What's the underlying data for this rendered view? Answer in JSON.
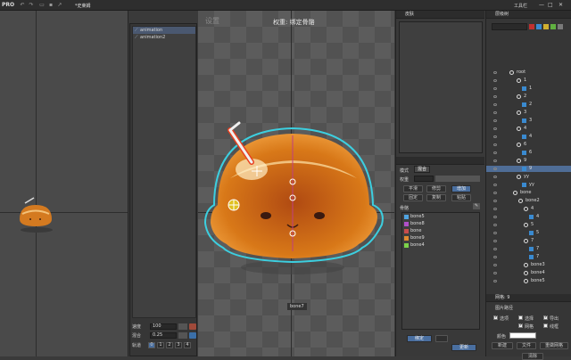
{
  "app": {
    "brand": "PRO",
    "tab_title": "*史莱姆",
    "window_controls": [
      "—",
      "□",
      "✕"
    ],
    "title_right_label": "工具栏"
  },
  "viewport": {
    "mode_label": "设置",
    "title": "权重: 绑定骨骼",
    "bone_label": "bone7"
  },
  "animations": {
    "items": [
      {
        "label": "animation",
        "selected": true
      },
      {
        "label": "animation2",
        "selected": false
      }
    ],
    "speed_label": "速度",
    "speed_value": "100",
    "mix_label": "混合",
    "mix_value": "0.25",
    "track_label": "轨道",
    "tracks": [
      "0",
      "1",
      "2",
      "3",
      "4"
    ]
  },
  "weights_panel": {
    "header": "皮肤",
    "mode_label": "模式",
    "mode_value": "混合",
    "weight_label": "权重",
    "buttons_row1": [
      "平滑",
      "修剪",
      "增加"
    ],
    "buttons_row2": [
      "固定",
      "复制",
      "粘贴"
    ],
    "bones_label": "骨骼",
    "bones": [
      {
        "name": "bone5",
        "color": "#4fa3e0"
      },
      {
        "name": "bone8",
        "color": "#b050c8"
      },
      {
        "name": "bone",
        "color": "#c84c4c"
      },
      {
        "name": "bone9",
        "color": "#e08a30"
      },
      {
        "name": "bone4",
        "color": "#7cd24a"
      }
    ],
    "bind_label": "绑定",
    "update_label": "更新"
  },
  "tree": {
    "header": "层级树",
    "search_placeholder": "",
    "rows": [
      {
        "label": "root",
        "indent": 26,
        "type": "bone"
      },
      {
        "label": "1",
        "indent": 34,
        "type": "bone"
      },
      {
        "label": "1",
        "indent": 40,
        "type": "slot"
      },
      {
        "label": "2",
        "indent": 34,
        "type": "bone"
      },
      {
        "label": "2",
        "indent": 40,
        "type": "slot"
      },
      {
        "label": "3",
        "indent": 34,
        "type": "bone"
      },
      {
        "label": "3",
        "indent": 40,
        "type": "slot"
      },
      {
        "label": "4",
        "indent": 34,
        "type": "bone"
      },
      {
        "label": "4",
        "indent": 40,
        "type": "slot"
      },
      {
        "label": "6",
        "indent": 34,
        "type": "bone"
      },
      {
        "label": "6",
        "indent": 40,
        "type": "slot"
      },
      {
        "label": "9",
        "indent": 34,
        "type": "bone"
      },
      {
        "label": "9",
        "indent": 40,
        "type": "slot",
        "selected": true
      },
      {
        "label": "yy",
        "indent": 34,
        "type": "bone"
      },
      {
        "label": "yy",
        "indent": 40,
        "type": "slot"
      },
      {
        "label": "bone",
        "indent": 30,
        "type": "bone"
      },
      {
        "label": "bone2",
        "indent": 36,
        "type": "bone"
      },
      {
        "label": "4",
        "indent": 42,
        "type": "bone"
      },
      {
        "label": "4",
        "indent": 48,
        "type": "slot"
      },
      {
        "label": "5",
        "indent": 42,
        "type": "bone"
      },
      {
        "label": "5",
        "indent": 48,
        "type": "slot"
      },
      {
        "label": "7",
        "indent": 42,
        "type": "bone"
      },
      {
        "label": "7",
        "indent": 48,
        "type": "slot"
      },
      {
        "label": "7",
        "indent": 48,
        "type": "slot"
      },
      {
        "label": "bone3",
        "indent": 42,
        "type": "bone"
      },
      {
        "label": "bone4",
        "indent": 42,
        "type": "bone"
      },
      {
        "label": "bone5",
        "indent": 42,
        "type": "bone"
      }
    ]
  },
  "properties": {
    "header": "网格: 9",
    "section": "图片路径",
    "checkboxes": [
      {
        "label": "选项",
        "checked": true
      },
      {
        "label": "选择",
        "checked": false
      },
      {
        "label": "导出",
        "checked": true
      },
      {
        "label": "网格",
        "checked": true
      },
      {
        "label": "线框",
        "checked": false
      }
    ],
    "color_label": "颜色",
    "actions": [
      "新建",
      "文件",
      "重做网格"
    ],
    "delete_label": "清除"
  },
  "colors": {
    "accent": "#4a6fa0",
    "selection": "#4f6d96"
  }
}
